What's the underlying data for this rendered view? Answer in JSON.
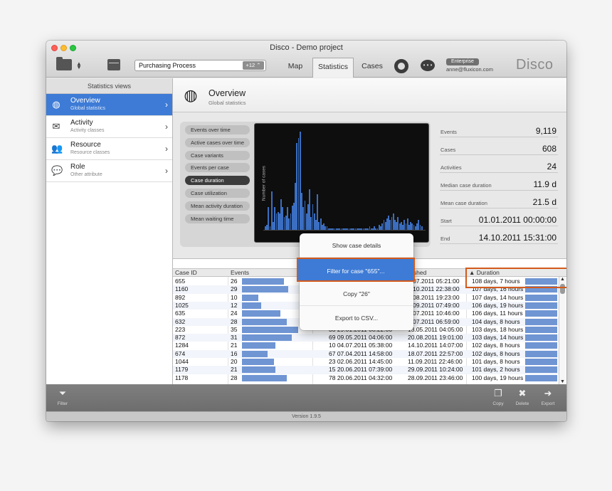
{
  "window": {
    "title": "Disco - Demo project"
  },
  "toolbar": {
    "process_name": "Purchasing Process",
    "process_badge": "+12 ⌃",
    "tabs": [
      "Map",
      "Statistics",
      "Cases"
    ],
    "active_tab": "Statistics",
    "license_badge": "Enterprise",
    "user_email": "anne@fluxicon.com",
    "brand": "Disco"
  },
  "sidebar": {
    "header": "Statistics views",
    "items": [
      {
        "title": "Overview",
        "subtitle": "Global statistics",
        "icon": "globe-icon"
      },
      {
        "title": "Activity",
        "subtitle": "Activity classes",
        "icon": "envelope-icon"
      },
      {
        "title": "Resource",
        "subtitle": "Resource classes",
        "icon": "people-icon"
      },
      {
        "title": "Role",
        "subtitle": "Other attribute",
        "icon": "speech-icon"
      }
    ]
  },
  "overview": {
    "title": "Overview",
    "subtitle": "Global statistics"
  },
  "chart_views": [
    "Events over time",
    "Active cases over time",
    "Case variants",
    "Events per case",
    "Case duration",
    "Case utilization",
    "Mean activity duration",
    "Mean waiting time"
  ],
  "active_chart_view": "Case duration",
  "chart_data": {
    "type": "bar",
    "ylabel": "Number of cases",
    "values": [
      2,
      3,
      14,
      2,
      24,
      5,
      14,
      10,
      11,
      10,
      19,
      14,
      8,
      9,
      14,
      7,
      10,
      15,
      17,
      29,
      54,
      57,
      61,
      23,
      14,
      18,
      10,
      16,
      25,
      8,
      16,
      10,
      6,
      22,
      5,
      7,
      3,
      4,
      2,
      2,
      1,
      1,
      1,
      1,
      1,
      1,
      1,
      1,
      1,
      1,
      1,
      1,
      1,
      1,
      1,
      1,
      1,
      1,
      1,
      1,
      1,
      1,
      1,
      1,
      1,
      1,
      2,
      1,
      1,
      2,
      1,
      1,
      3,
      2,
      4,
      6,
      5,
      7,
      9,
      6,
      8,
      10,
      6,
      5,
      8,
      4,
      5,
      3,
      6,
      4,
      7,
      3,
      5,
      4,
      3,
      2,
      4,
      6,
      3,
      2
    ]
  },
  "metrics": [
    {
      "label": "Events",
      "value": "9,119"
    },
    {
      "label": "Cases",
      "value": "608"
    },
    {
      "label": "Activities",
      "value": "24"
    },
    {
      "label": "Median case duration",
      "value": "11.9 d"
    },
    {
      "label": "Mean case duration",
      "value": "21.5 d"
    },
    {
      "label": "Start",
      "value": "01.01.2011 00:00:00"
    },
    {
      "label": "End",
      "value": "14.10.2011 15:31:00"
    }
  ],
  "table": {
    "columns": {
      "case_id": "Case ID",
      "events": "Events",
      "finished": "ished",
      "duration": "▲ Duration"
    },
    "rows": [
      {
        "id": "655",
        "events": "26",
        "ev": 26,
        "mid": "",
        "fin": "5.07.2011 05:21:00",
        "dur": "108 days, 7 hours"
      },
      {
        "id": "1160",
        "events": "29",
        "ev": 29,
        "mid": "",
        "fin": "3.10.2011 22:38:00",
        "dur": "107 days, 16 hours"
      },
      {
        "id": "892",
        "events": "10",
        "ev": 10,
        "mid": "",
        "fin": "5.08.2011 19:23:00",
        "dur": "107 days, 14 hours"
      },
      {
        "id": "1025",
        "events": "12",
        "ev": 12,
        "mid": "",
        "fin": "3.09.2011 07:49:00",
        "dur": "106 days, 19 hours"
      },
      {
        "id": "635",
        "events": "24",
        "ev": 24,
        "mid": "",
        "fin": "5.07.2011 10:46:00",
        "dur": "106 days, 11 hours"
      },
      {
        "id": "632",
        "events": "28",
        "ev": 28,
        "mid": "",
        "fin": "5.07.2011 06:59:00",
        "dur": "104 days, 8 hours"
      },
      {
        "id": "223",
        "events": "35",
        "ev": 35,
        "mid": "33   29.01.2011 08:22:00",
        "fin": "13.05.2011 04:05:00",
        "dur": "103 days, 18 hours"
      },
      {
        "id": "872",
        "events": "31",
        "ev": 31,
        "mid": "69   09.05.2011 04:06:00",
        "fin": "20.08.2011 19:01:00",
        "dur": "103 days, 14 hours"
      },
      {
        "id": "1284",
        "events": "21",
        "ev": 21,
        "mid": "10   04.07.2011 05:38:00",
        "fin": "14.10.2011 14:07:00",
        "dur": "102 days, 8 hours"
      },
      {
        "id": "674",
        "events": "16",
        "ev": 16,
        "mid": "67   07.04.2011 14:58:00",
        "fin": "18.07.2011 22:57:00",
        "dur": "102 days, 8 hours"
      },
      {
        "id": "1044",
        "events": "20",
        "ev": 20,
        "mid": "23   02.06.2011 14:45:00",
        "fin": "11.09.2011 22:46:00",
        "dur": "101 days, 8 hours"
      },
      {
        "id": "1179",
        "events": "21",
        "ev": 21,
        "mid": "15   20.06.2011 07:39:00",
        "fin": "29.09.2011 10:24:00",
        "dur": "101 days, 2 hours"
      },
      {
        "id": "1178",
        "events": "28",
        "ev": 28,
        "mid": "78   20.06.2011 04:32:00",
        "fin": "28.09.2011 23:46:00",
        "dur": "100 days, 19 hours"
      }
    ]
  },
  "context_menu": {
    "items": [
      "Show case details",
      "Filter for case \"655\"...",
      "Copy \"26\"",
      "Export to CSV..."
    ],
    "highlighted": "Filter for case \"655\"..."
  },
  "bottom_bar": {
    "filter": "Filter",
    "copy": "Copy",
    "delete": "Delete",
    "export": "Export"
  },
  "status": {
    "version": "Version 1.9.5"
  }
}
